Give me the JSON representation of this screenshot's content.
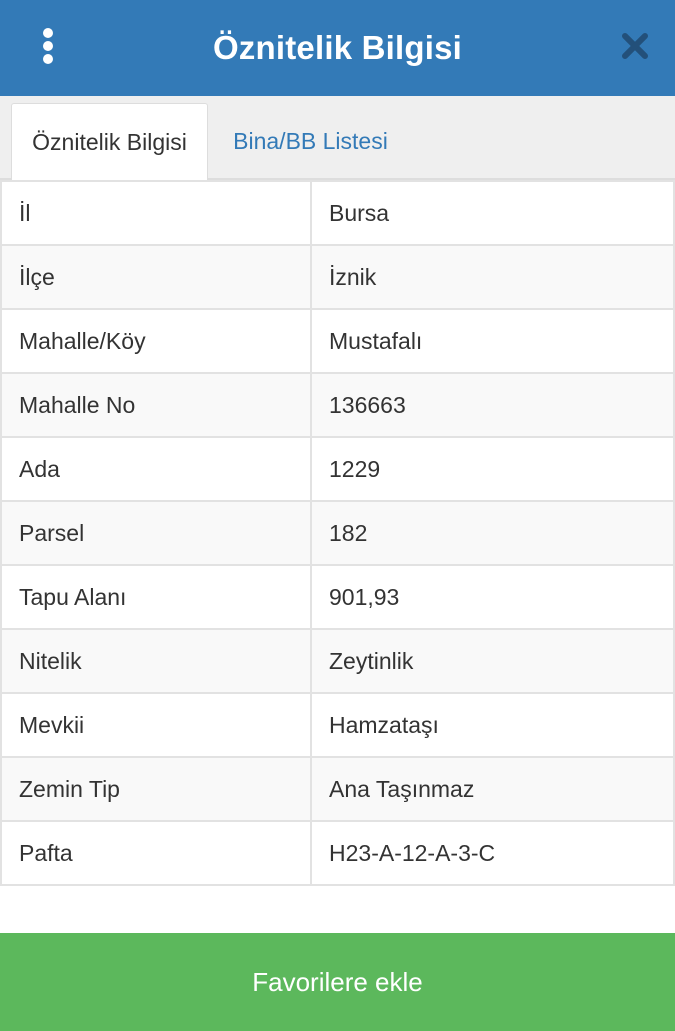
{
  "header": {
    "title": "Öznitelik Bilgisi",
    "menu_icon": "vertical-dots-icon",
    "close_icon": "close-icon",
    "color": "#337ab7"
  },
  "tabs": [
    {
      "label": "Öznitelik Bilgisi",
      "active": true
    },
    {
      "label": "Bina/BB Listesi",
      "active": false
    }
  ],
  "attributes": [
    {
      "key": "İl",
      "value": "Bursa"
    },
    {
      "key": "İlçe",
      "value": "İznik"
    },
    {
      "key": "Mahalle/Köy",
      "value": "Mustafalı"
    },
    {
      "key": "Mahalle No",
      "value": "136663"
    },
    {
      "key": "Ada",
      "value": "1229"
    },
    {
      "key": "Parsel",
      "value": "182"
    },
    {
      "key": "Tapu Alanı",
      "value": "901,93"
    },
    {
      "key": "Nitelik",
      "value": "Zeytinlik"
    },
    {
      "key": "Mevkii",
      "value": "Hamzataşı"
    },
    {
      "key": "Zemin Tip",
      "value": "Ana Taşınmaz"
    },
    {
      "key": "Pafta",
      "value": "H23-A-12-A-3-C"
    }
  ],
  "footer": {
    "favorite_label": "Favorilere ekle",
    "color": "#5cb85c"
  }
}
